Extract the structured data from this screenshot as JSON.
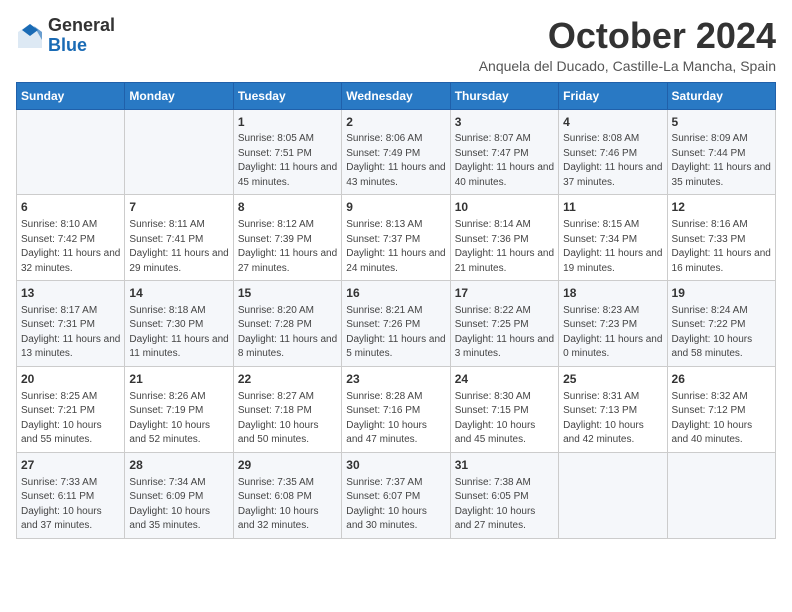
{
  "header": {
    "logo_general": "General",
    "logo_blue": "Blue",
    "title": "October 2024",
    "subtitle": "Anquela del Ducado, Castille-La Mancha, Spain"
  },
  "days_of_week": [
    "Sunday",
    "Monday",
    "Tuesday",
    "Wednesday",
    "Thursday",
    "Friday",
    "Saturday"
  ],
  "weeks": [
    [
      {
        "day": "",
        "detail": ""
      },
      {
        "day": "",
        "detail": ""
      },
      {
        "day": "1",
        "detail": "Sunrise: 8:05 AM\nSunset: 7:51 PM\nDaylight: 11 hours and 45 minutes."
      },
      {
        "day": "2",
        "detail": "Sunrise: 8:06 AM\nSunset: 7:49 PM\nDaylight: 11 hours and 43 minutes."
      },
      {
        "day": "3",
        "detail": "Sunrise: 8:07 AM\nSunset: 7:47 PM\nDaylight: 11 hours and 40 minutes."
      },
      {
        "day": "4",
        "detail": "Sunrise: 8:08 AM\nSunset: 7:46 PM\nDaylight: 11 hours and 37 minutes."
      },
      {
        "day": "5",
        "detail": "Sunrise: 8:09 AM\nSunset: 7:44 PM\nDaylight: 11 hours and 35 minutes."
      }
    ],
    [
      {
        "day": "6",
        "detail": "Sunrise: 8:10 AM\nSunset: 7:42 PM\nDaylight: 11 hours and 32 minutes."
      },
      {
        "day": "7",
        "detail": "Sunrise: 8:11 AM\nSunset: 7:41 PM\nDaylight: 11 hours and 29 minutes."
      },
      {
        "day": "8",
        "detail": "Sunrise: 8:12 AM\nSunset: 7:39 PM\nDaylight: 11 hours and 27 minutes."
      },
      {
        "day": "9",
        "detail": "Sunrise: 8:13 AM\nSunset: 7:37 PM\nDaylight: 11 hours and 24 minutes."
      },
      {
        "day": "10",
        "detail": "Sunrise: 8:14 AM\nSunset: 7:36 PM\nDaylight: 11 hours and 21 minutes."
      },
      {
        "day": "11",
        "detail": "Sunrise: 8:15 AM\nSunset: 7:34 PM\nDaylight: 11 hours and 19 minutes."
      },
      {
        "day": "12",
        "detail": "Sunrise: 8:16 AM\nSunset: 7:33 PM\nDaylight: 11 hours and 16 minutes."
      }
    ],
    [
      {
        "day": "13",
        "detail": "Sunrise: 8:17 AM\nSunset: 7:31 PM\nDaylight: 11 hours and 13 minutes."
      },
      {
        "day": "14",
        "detail": "Sunrise: 8:18 AM\nSunset: 7:30 PM\nDaylight: 11 hours and 11 minutes."
      },
      {
        "day": "15",
        "detail": "Sunrise: 8:20 AM\nSunset: 7:28 PM\nDaylight: 11 hours and 8 minutes."
      },
      {
        "day": "16",
        "detail": "Sunrise: 8:21 AM\nSunset: 7:26 PM\nDaylight: 11 hours and 5 minutes."
      },
      {
        "day": "17",
        "detail": "Sunrise: 8:22 AM\nSunset: 7:25 PM\nDaylight: 11 hours and 3 minutes."
      },
      {
        "day": "18",
        "detail": "Sunrise: 8:23 AM\nSunset: 7:23 PM\nDaylight: 11 hours and 0 minutes."
      },
      {
        "day": "19",
        "detail": "Sunrise: 8:24 AM\nSunset: 7:22 PM\nDaylight: 10 hours and 58 minutes."
      }
    ],
    [
      {
        "day": "20",
        "detail": "Sunrise: 8:25 AM\nSunset: 7:21 PM\nDaylight: 10 hours and 55 minutes."
      },
      {
        "day": "21",
        "detail": "Sunrise: 8:26 AM\nSunset: 7:19 PM\nDaylight: 10 hours and 52 minutes."
      },
      {
        "day": "22",
        "detail": "Sunrise: 8:27 AM\nSunset: 7:18 PM\nDaylight: 10 hours and 50 minutes."
      },
      {
        "day": "23",
        "detail": "Sunrise: 8:28 AM\nSunset: 7:16 PM\nDaylight: 10 hours and 47 minutes."
      },
      {
        "day": "24",
        "detail": "Sunrise: 8:30 AM\nSunset: 7:15 PM\nDaylight: 10 hours and 45 minutes."
      },
      {
        "day": "25",
        "detail": "Sunrise: 8:31 AM\nSunset: 7:13 PM\nDaylight: 10 hours and 42 minutes."
      },
      {
        "day": "26",
        "detail": "Sunrise: 8:32 AM\nSunset: 7:12 PM\nDaylight: 10 hours and 40 minutes."
      }
    ],
    [
      {
        "day": "27",
        "detail": "Sunrise: 7:33 AM\nSunset: 6:11 PM\nDaylight: 10 hours and 37 minutes."
      },
      {
        "day": "28",
        "detail": "Sunrise: 7:34 AM\nSunset: 6:09 PM\nDaylight: 10 hours and 35 minutes."
      },
      {
        "day": "29",
        "detail": "Sunrise: 7:35 AM\nSunset: 6:08 PM\nDaylight: 10 hours and 32 minutes."
      },
      {
        "day": "30",
        "detail": "Sunrise: 7:37 AM\nSunset: 6:07 PM\nDaylight: 10 hours and 30 minutes."
      },
      {
        "day": "31",
        "detail": "Sunrise: 7:38 AM\nSunset: 6:05 PM\nDaylight: 10 hours and 27 minutes."
      },
      {
        "day": "",
        "detail": ""
      },
      {
        "day": "",
        "detail": ""
      }
    ]
  ]
}
